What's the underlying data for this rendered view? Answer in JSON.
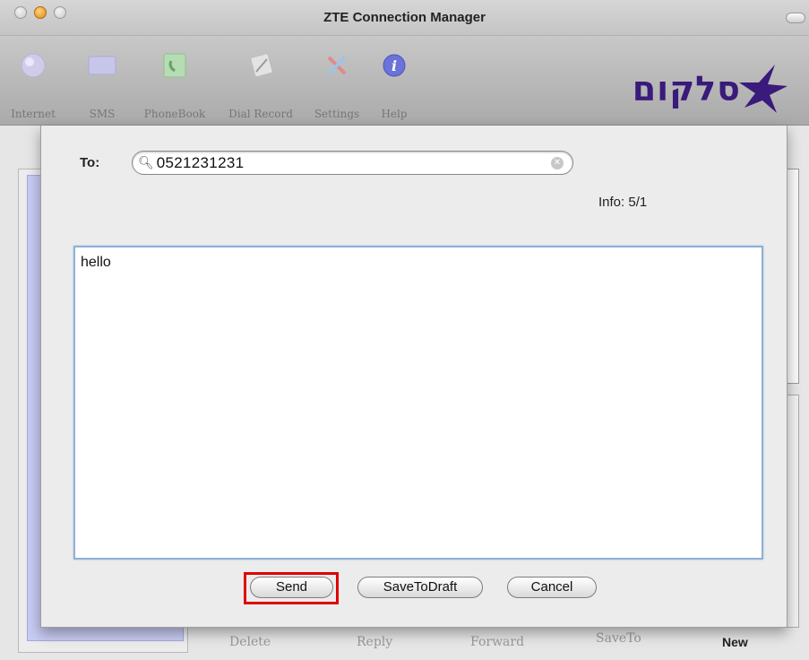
{
  "window": {
    "title": "ZTE Connection Manager"
  },
  "toolbar": {
    "items": [
      {
        "label": "Internet",
        "icon": "globe-icon"
      },
      {
        "label": "SMS",
        "icon": "envelope-icon"
      },
      {
        "label": "PhoneBook",
        "icon": "phonebook-icon"
      },
      {
        "label": "Dial Record",
        "icon": "dial-record-icon"
      },
      {
        "label": "Settings",
        "icon": "settings-tools-icon"
      },
      {
        "label": "Help",
        "icon": "info-icon"
      }
    ]
  },
  "logo": {
    "text": "סלקום",
    "accent": "#3a1a7a"
  },
  "background": {
    "bottom_actions": [
      {
        "label": "Delete"
      },
      {
        "label": "Reply"
      },
      {
        "label": "Forward"
      },
      {
        "label": "SaveTo"
      },
      {
        "label": "New"
      }
    ]
  },
  "sheet": {
    "to_label": "To:",
    "recipient_value": "0521231231",
    "info_label": "Info: 5/1",
    "message_text": "hello",
    "buttons": {
      "send": "Send",
      "save_to_draft": "SaveToDraft",
      "cancel": "Cancel"
    },
    "highlight_color": "#e00000"
  }
}
